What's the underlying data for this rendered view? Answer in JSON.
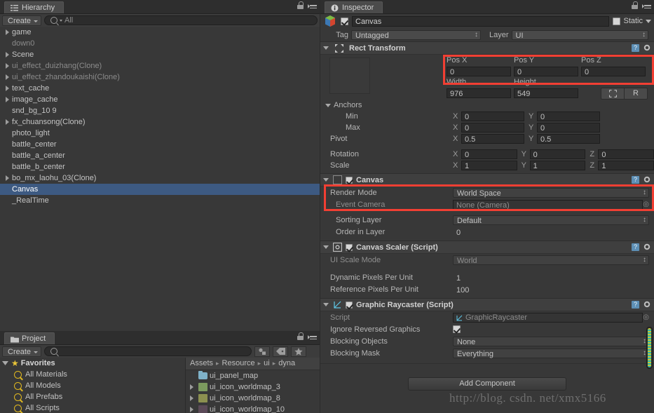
{
  "hierarchy": {
    "tab_label": "Hierarchy",
    "create_label": "Create",
    "search_value": "All",
    "items": [
      {
        "label": "game",
        "arrow": "closed",
        "dim": false,
        "selected": false
      },
      {
        "label": "down0",
        "arrow": "none",
        "dim": true,
        "selected": false
      },
      {
        "label": "Scene",
        "arrow": "closed",
        "dim": false,
        "selected": false
      },
      {
        "label": "ui_effect_duizhang(Clone)",
        "arrow": "closed",
        "dim": true,
        "selected": false
      },
      {
        "label": "ui_effect_zhandoukaishi(Clone)",
        "arrow": "closed",
        "dim": true,
        "selected": false
      },
      {
        "label": "text_cache",
        "arrow": "closed",
        "dim": false,
        "selected": false
      },
      {
        "label": "image_cache",
        "arrow": "closed",
        "dim": false,
        "selected": false
      },
      {
        "label": "snd_bg_10 9",
        "arrow": "none",
        "dim": false,
        "selected": false
      },
      {
        "label": "fx_chuansong(Clone)",
        "arrow": "closed",
        "dim": false,
        "selected": false
      },
      {
        "label": "photo_light",
        "arrow": "none",
        "dim": false,
        "selected": false
      },
      {
        "label": "battle_center",
        "arrow": "none",
        "dim": false,
        "selected": false
      },
      {
        "label": "battle_a_center",
        "arrow": "none",
        "dim": false,
        "selected": false
      },
      {
        "label": "battle_b_center",
        "arrow": "none",
        "dim": false,
        "selected": false
      },
      {
        "label": "bo_mx_laohu_03(Clone)",
        "arrow": "closed",
        "dim": false,
        "selected": false
      },
      {
        "label": "Canvas",
        "arrow": "none",
        "dim": false,
        "selected": true
      },
      {
        "label": "_RealTime",
        "arrow": "none",
        "dim": false,
        "selected": false
      }
    ]
  },
  "project": {
    "tab_label": "Project",
    "create_label": "Create",
    "search_value": "",
    "favorites_label": "Favorites",
    "favorites": [
      {
        "label": "All Materials"
      },
      {
        "label": "All Models"
      },
      {
        "label": "All Prefabs"
      },
      {
        "label": "All Scripts"
      }
    ],
    "breadcrumb": [
      "Assets",
      "Resource",
      "ui",
      "dyna"
    ],
    "assets": [
      {
        "label": "ui_panel_map",
        "kind": "folder",
        "arrow": false,
        "color": "#7fb2c9"
      },
      {
        "label": "ui_icon_worldmap_3",
        "kind": "texture",
        "arrow": true,
        "color": "#7c9a5e"
      },
      {
        "label": "ui_icon_worldmap_8",
        "kind": "texture",
        "arrow": true,
        "color": "#8c9050"
      },
      {
        "label": "ui_icon_worldmap_10",
        "kind": "texture",
        "arrow": true,
        "color": "#5b4a58"
      }
    ]
  },
  "inspector": {
    "tab_label": "Inspector",
    "object_name": "Canvas",
    "object_enabled": true,
    "static_label": "Static",
    "tag_label": "Tag",
    "tag_value": "Untagged",
    "layer_label": "Layer",
    "layer_value": "UI",
    "rect_transform": {
      "title": "Rect Transform",
      "pos_labels": [
        "Pos X",
        "Pos Y",
        "Pos Z"
      ],
      "pos_values": [
        "0",
        "0",
        "0"
      ],
      "size_labels": [
        "Width",
        "Height"
      ],
      "size_values": [
        "976",
        "549"
      ],
      "blueprint_label": "",
      "raw_label": "R",
      "anchors_label": "Anchors",
      "min_label": "Min",
      "min_x": "0",
      "min_y": "0",
      "max_label": "Max",
      "max_x": "0",
      "max_y": "0",
      "pivot_label": "Pivot",
      "pivot_x": "0.5",
      "pivot_y": "0.5",
      "rotation_label": "Rotation",
      "rotation_x": "0",
      "rotation_y": "0",
      "rotation_z": "0",
      "scale_label": "Scale",
      "scale_x": "1",
      "scale_y": "1",
      "scale_z": "1"
    },
    "canvas": {
      "title": "Canvas",
      "enabled": true,
      "render_mode_label": "Render Mode",
      "render_mode_value": "World Space",
      "event_camera_label": "Event Camera",
      "event_camera_value": "None (Camera)",
      "sorting_layer_label": "Sorting Layer",
      "sorting_layer_value": "Default",
      "order_in_layer_label": "Order in Layer",
      "order_in_layer_value": "0"
    },
    "canvas_scaler": {
      "title": "Canvas Scaler (Script)",
      "enabled": true,
      "ui_scale_mode_label": "UI Scale Mode",
      "ui_scale_mode_value": "World",
      "dynamic_ppu_label": "Dynamic Pixels Per Unit",
      "dynamic_ppu_value": "1",
      "reference_ppu_label": "Reference Pixels Per Unit",
      "reference_ppu_value": "100"
    },
    "graphic_raycaster": {
      "title": "Graphic Raycaster (Script)",
      "enabled": true,
      "script_label": "Script",
      "script_value": "GraphicRaycaster",
      "ignore_reversed_label": "Ignore Reversed Graphics",
      "ignore_reversed_checked": true,
      "blocking_objects_label": "Blocking Objects",
      "blocking_objects_value": "None",
      "blocking_mask_label": "Blocking Mask",
      "blocking_mask_value": "Everything"
    },
    "add_component_label": "Add Component"
  },
  "watermark": "http://blog. csdn. net/xmx5166",
  "colors": {
    "selection": "#3d5a82",
    "highlight_box": "#f23f33",
    "panel_bg": "#383838",
    "field_bg": "#2c2c2c"
  }
}
